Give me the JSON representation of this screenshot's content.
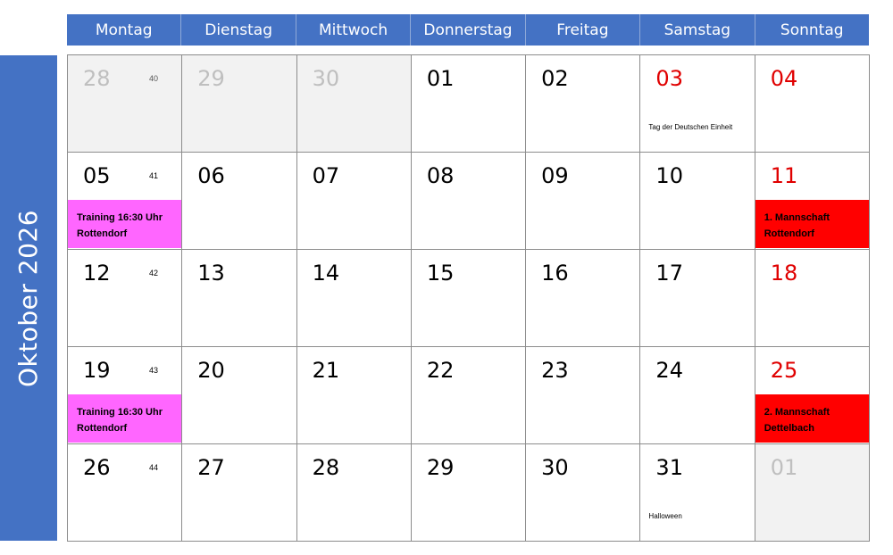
{
  "month_title": "Oktober 2026",
  "weekdays": [
    "Montag",
    "Dienstag",
    "Mittwoch",
    "Donnerstag",
    "Freitag",
    "Samstag",
    "Sonntag"
  ],
  "colors": {
    "header": "#4472c4",
    "weekend_number": "#e00000",
    "other_month_bg": "#f2f2f2",
    "training_event": "#ff66ff",
    "match_event": "#ff0000"
  },
  "weeks": [
    {
      "kw": "40",
      "days": [
        {
          "num": "28",
          "other": true
        },
        {
          "num": "29",
          "other": true
        },
        {
          "num": "30",
          "other": true
        },
        {
          "num": "01"
        },
        {
          "num": "02"
        },
        {
          "num": "03",
          "weekend": true,
          "holiday": "Tag der Deutschen Einheit"
        },
        {
          "num": "04",
          "weekend": true
        }
      ]
    },
    {
      "kw": "41",
      "days": [
        {
          "num": "05",
          "event": {
            "text": "Training 16:30 Uhr\nRottendorf",
            "kind": "pink"
          }
        },
        {
          "num": "06"
        },
        {
          "num": "07"
        },
        {
          "num": "08"
        },
        {
          "num": "09"
        },
        {
          "num": "10"
        },
        {
          "num": "11",
          "weekend": true,
          "event": {
            "text": "1. Mannschaft\nRottendorf",
            "kind": "red"
          }
        }
      ]
    },
    {
      "kw": "42",
      "days": [
        {
          "num": "12"
        },
        {
          "num": "13"
        },
        {
          "num": "14"
        },
        {
          "num": "15"
        },
        {
          "num": "16"
        },
        {
          "num": "17"
        },
        {
          "num": "18",
          "weekend": true
        }
      ]
    },
    {
      "kw": "43",
      "days": [
        {
          "num": "19",
          "event": {
            "text": "Training 16:30 Uhr\nRottendorf",
            "kind": "pink"
          }
        },
        {
          "num": "20"
        },
        {
          "num": "21"
        },
        {
          "num": "22"
        },
        {
          "num": "23"
        },
        {
          "num": "24"
        },
        {
          "num": "25",
          "weekend": true,
          "event": {
            "text": "2. Mannschaft\nDettelbach",
            "kind": "red"
          }
        }
      ]
    },
    {
      "kw": "44",
      "days": [
        {
          "num": "26"
        },
        {
          "num": "27"
        },
        {
          "num": "28"
        },
        {
          "num": "29"
        },
        {
          "num": "30"
        },
        {
          "num": "31",
          "holiday": "Halloween"
        },
        {
          "num": "01",
          "other": true,
          "weekend": true
        }
      ]
    }
  ]
}
